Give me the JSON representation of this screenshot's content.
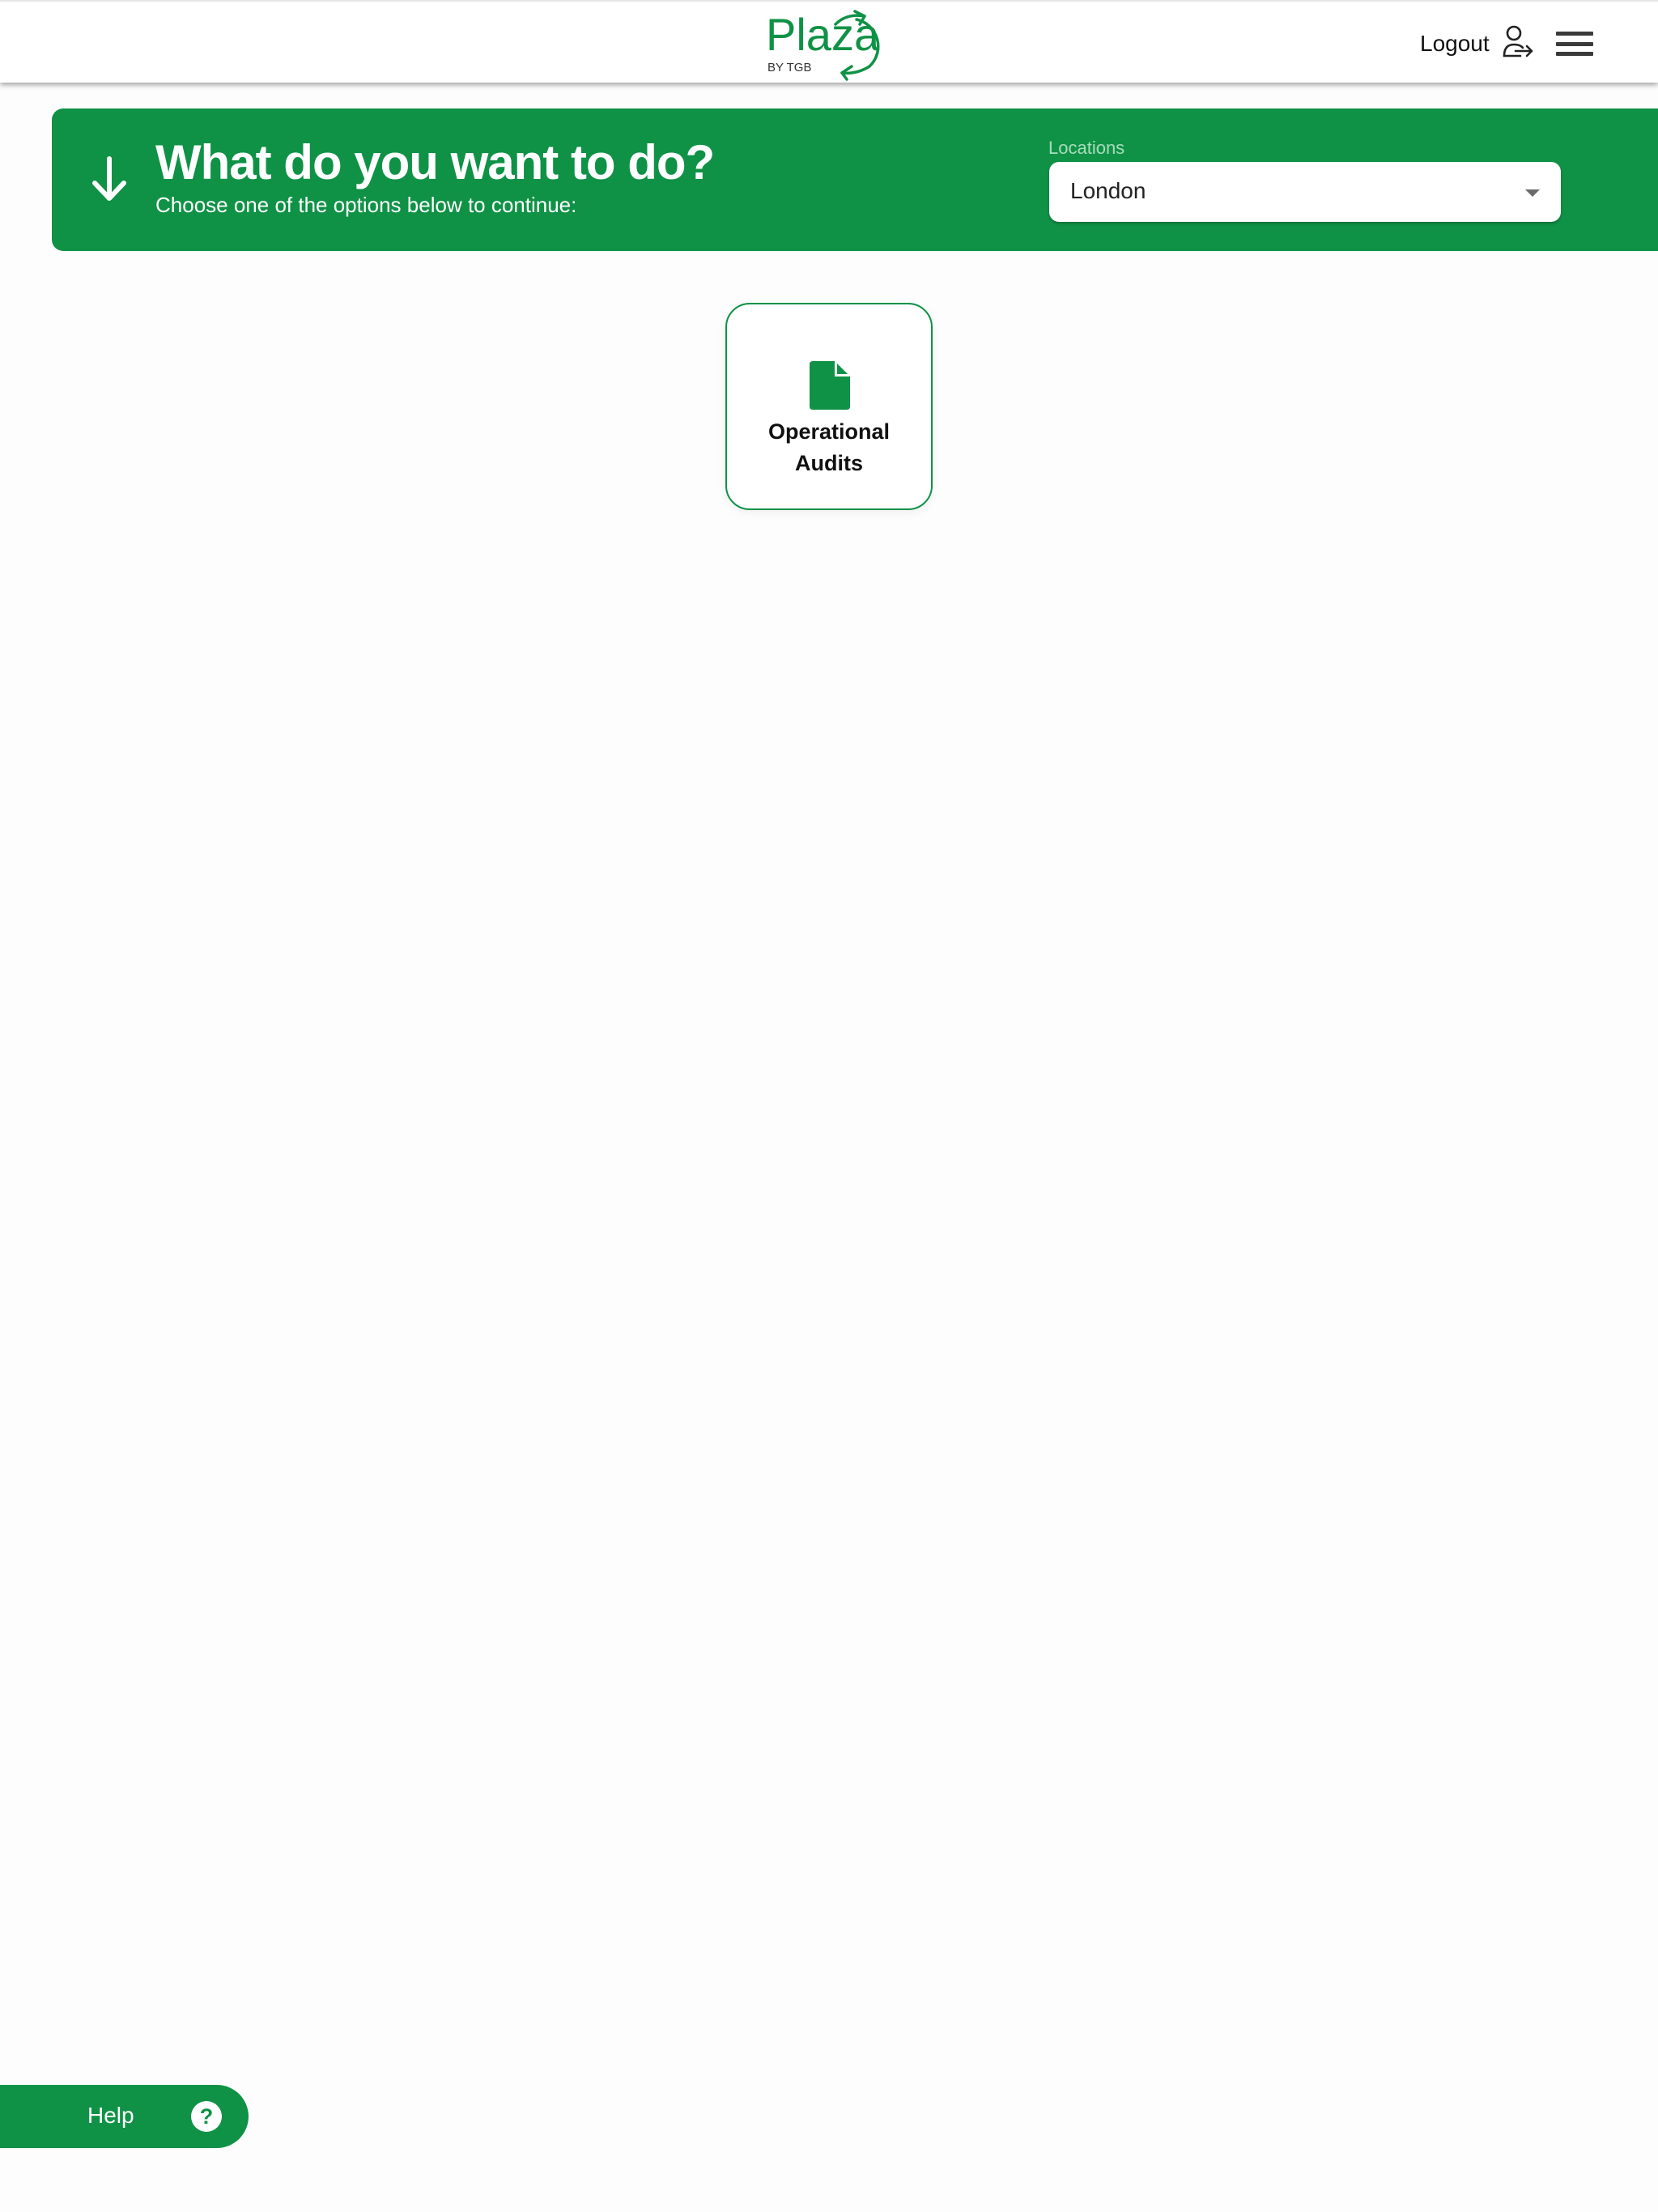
{
  "header": {
    "logo": {
      "wordmark": "Plaza",
      "tagline": "BY TGB"
    },
    "logout_label": "Logout"
  },
  "banner": {
    "title": "What do you want to do?",
    "subtitle": "Choose one of the options below to continue:",
    "locations": {
      "label": "Locations",
      "selected": "London"
    }
  },
  "options": [
    {
      "label_line1": "Operational",
      "label_line2": "Audits",
      "icon": "document-icon"
    }
  ],
  "help": {
    "label": "Help",
    "icon_glyph": "?"
  },
  "colors": {
    "brand_green": "#0f9246",
    "header_bg": "#ffffff",
    "page_bg": "#fdfdfd"
  }
}
